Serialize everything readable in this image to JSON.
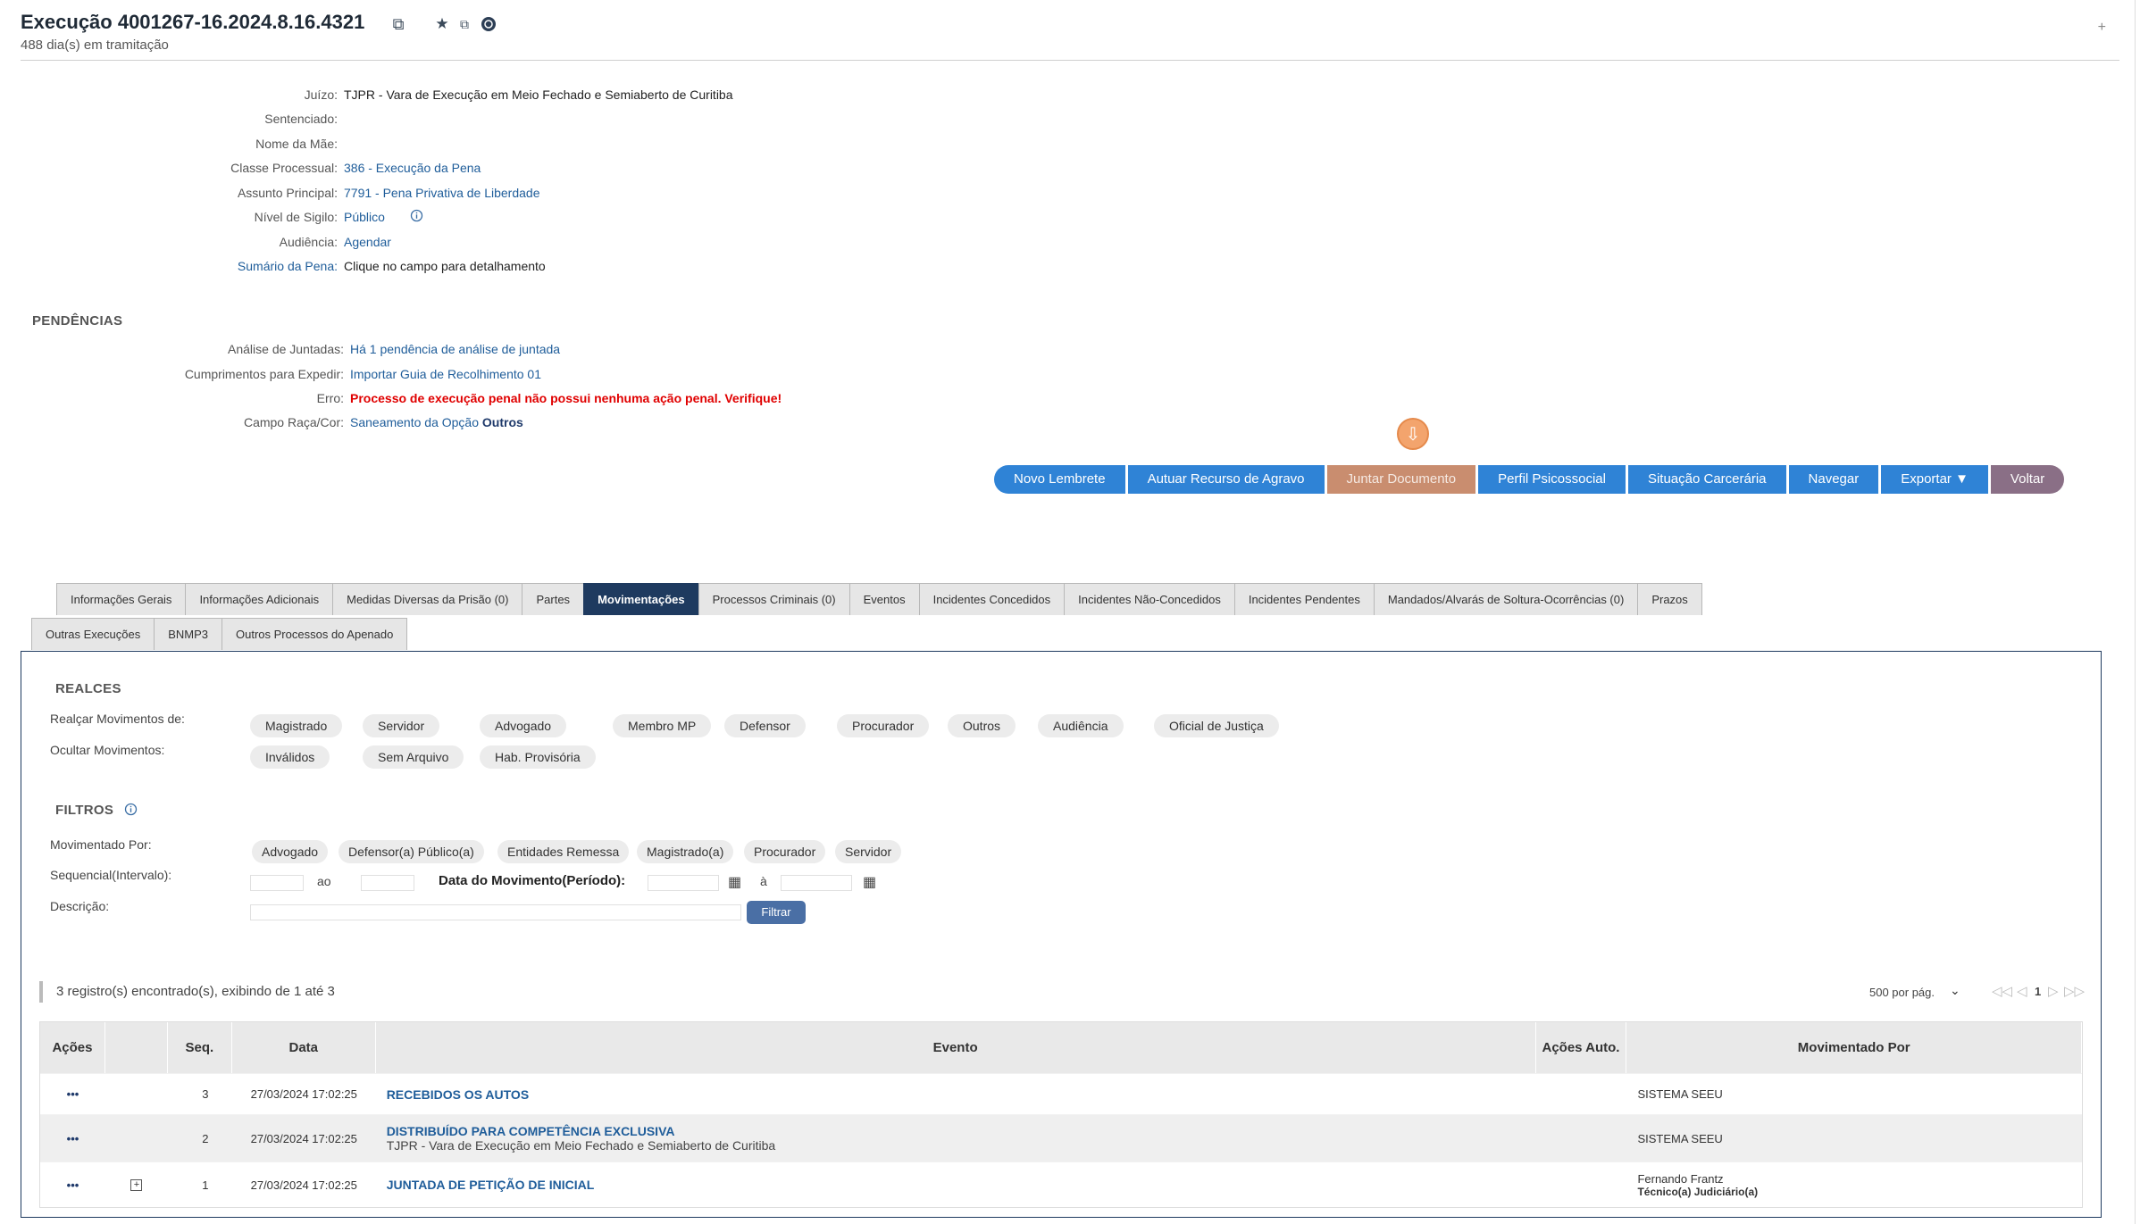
{
  "header": {
    "title": "Execução 4001267-16.2024.8.16.4321",
    "subtitle": "488 dia(s) em tramitação",
    "plus": "+"
  },
  "info": [
    {
      "label": "Juízo:",
      "value": "TJPR - Vara de Execução em Meio Fechado e Semiaberto de Curitiba",
      "link": false
    },
    {
      "label": "Sentenciado:",
      "value": "",
      "link": false
    },
    {
      "label": "Nome da Mãe:",
      "value": "",
      "link": false
    },
    {
      "label": "Classe Processual:",
      "value": "386 - Execução da Pena",
      "link": true
    },
    {
      "label": "Assunto Principal:",
      "value": "7791 - Pena Privativa de Liberdade",
      "link": true
    },
    {
      "label": "Nível de Sigilo:",
      "value": "Público",
      "link": true
    },
    {
      "label": "Audiência:",
      "value": "Agendar",
      "link": true
    },
    {
      "label": "Sumário da Pena:",
      "value": "Clique no campo para detalhamento",
      "link": false
    }
  ],
  "pendencias": {
    "heading": "PENDÊNCIAS",
    "rows": [
      {
        "label": "Análise de Juntadas:",
        "value": "Há 1 pendência de análise de juntada"
      },
      {
        "label": "Cumprimentos para Expedir:",
        "value": "Importar Guia de Recolhimento 01"
      },
      {
        "label": "Erro:",
        "value": "Processo de execução penal não possui nenhuma ação penal. Verifique!"
      },
      {
        "label": "Campo Raça/Cor:",
        "value": "Saneamento da Opção",
        "value_bold": "Outros"
      }
    ]
  },
  "actions": [
    "Novo Lembrete",
    "Autuar Recurso de Agravo",
    "Juntar Documento",
    "Perfil Psicossocial",
    "Situação Carcerária",
    "Navegar",
    "Exportar ▼",
    "Voltar"
  ],
  "tabs_row1": [
    "Informações Gerais",
    "Informações Adicionais",
    "Medidas Diversas da Prisão (0)",
    "Partes",
    "Movimentações",
    "Processos Criminais (0)",
    "Eventos",
    "Incidentes Concedidos",
    "Incidentes Não-Concedidos",
    "Incidentes Pendentes",
    "Mandados/Alvarás de Soltura-Ocorrências (0)",
    "Prazos"
  ],
  "tabs_row2": [
    "Outras Execuções",
    "BNMP3",
    "Outros Processos do Apenado"
  ],
  "realces": {
    "heading": "REALCES",
    "realcar_label": "Realçar Movimentos de:",
    "realcar": [
      "Magistrado",
      "Servidor",
      "Advogado",
      "Membro MP",
      "Defensor",
      "Procurador",
      "Outros",
      "Audiência",
      "Oficial de Justiça"
    ],
    "ocultar_label": "Ocultar Movimentos:",
    "ocultar": [
      "Inválidos",
      "Sem Arquivo",
      "Hab. Provisória"
    ]
  },
  "filtros": {
    "heading": "FILTROS",
    "mov_por_label": "Movimentado Por:",
    "mov_por": [
      "Advogado",
      "Defensor(a) Público(a)",
      "Entidades Remessa",
      "Magistrado(a)",
      "Procurador",
      "Servidor"
    ],
    "seq_label": "Sequencial(Intervalo):",
    "ao": "ao",
    "data_label": "Data do Movimento(Período):",
    "a": "à",
    "desc_label": "Descrição:",
    "filtrar": "Filtrar"
  },
  "results": {
    "summary": "3 registro(s) encontrado(s), exibindo de 1 até 3",
    "per_page": "500 por pág.",
    "page": "1"
  },
  "table": {
    "headers": [
      "Ações",
      "",
      "Seq.",
      "Data",
      "Evento",
      "Ações Auto.",
      "Movimentado Por"
    ],
    "rows": [
      {
        "acoes": "•••",
        "seq": "3",
        "data": "27/03/2024 17:02:25",
        "evento": "RECEBIDOS OS AUTOS",
        "evento_sub": "",
        "mov": "SISTEMA SEEU",
        "mov_sub": ""
      },
      {
        "acoes": "•••",
        "seq": "2",
        "data": "27/03/2024 17:02:25",
        "evento": "DISTRIBUÍDO PARA COMPETÊNCIA EXCLUSIVA",
        "evento_sub": "TJPR - Vara de Execução em Meio Fechado e Semiaberto de Curitiba",
        "mov": "SISTEMA SEEU",
        "mov_sub": ""
      },
      {
        "acoes": "•••",
        "seq": "1",
        "data": "27/03/2024 17:02:25",
        "evento": "JUNTADA DE PETIÇÃO DE INICIAL",
        "evento_sub": "",
        "mov": "Fernando Frantz",
        "mov_sub": "Técnico(a) Judiciário(a)"
      }
    ]
  }
}
